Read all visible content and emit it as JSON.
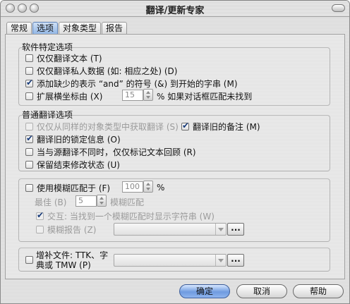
{
  "window": {
    "title": "翻译/更新专家"
  },
  "tabs": [
    {
      "label": "常规",
      "active": false
    },
    {
      "label": "选项",
      "active": true
    },
    {
      "label": "对象类型",
      "active": false
    },
    {
      "label": "报告",
      "active": false
    }
  ],
  "software_section": {
    "title": "软件特定选项",
    "options": [
      {
        "label": "仅仅翻译文本 (T)",
        "checked": false,
        "enabled": true
      },
      {
        "label": "仅仅翻译私人数据 (如: 相应之处) (D)",
        "checked": false,
        "enabled": true
      },
      {
        "label": "添加缺少的表示 “and” 的符号 (&) 到开始的字串 (M)",
        "checked": true,
        "enabled": true
      },
      {
        "label": "扩展横坐标由 (X)",
        "checked": false,
        "enabled": true,
        "value": "15",
        "suffix": "% 如果对话框匹配未找到"
      }
    ]
  },
  "general_section": {
    "title": "普通翻译选项",
    "options": [
      {
        "label": "仅仅从同样的对象类型中获取翻译 (S)",
        "checked": false,
        "enabled": false
      },
      {
        "label": "翻译旧的备注 (M)",
        "checked": true,
        "enabled": true
      },
      {
        "label": "翻译旧的锁定信息 (O)",
        "checked": true,
        "enabled": true
      },
      {
        "label": "当与源翻译不同时，仅仅标记文本回顾 (R)",
        "checked": false,
        "enabled": true
      },
      {
        "label": "保留结束修改状态 (U)",
        "checked": false,
        "enabled": true
      }
    ]
  },
  "fuzzy": {
    "label": "使用模糊匹配于 (F)",
    "value": "100",
    "unit": "%",
    "best_label": "最佳 (B)",
    "best_value": "5",
    "best_suffix": "模糊匹配",
    "interactive_label": "交互: 当找到一个模糊匹配时显示字符串 (W)",
    "report_label": "模糊报告 (Z)"
  },
  "supplement": {
    "label_line1": "增补文件: TTK、字",
    "label_line2": "典或 TMW (P)"
  },
  "buttons": {
    "ok": "确定",
    "cancel": "取消",
    "help": "帮助",
    "browse": "..."
  }
}
